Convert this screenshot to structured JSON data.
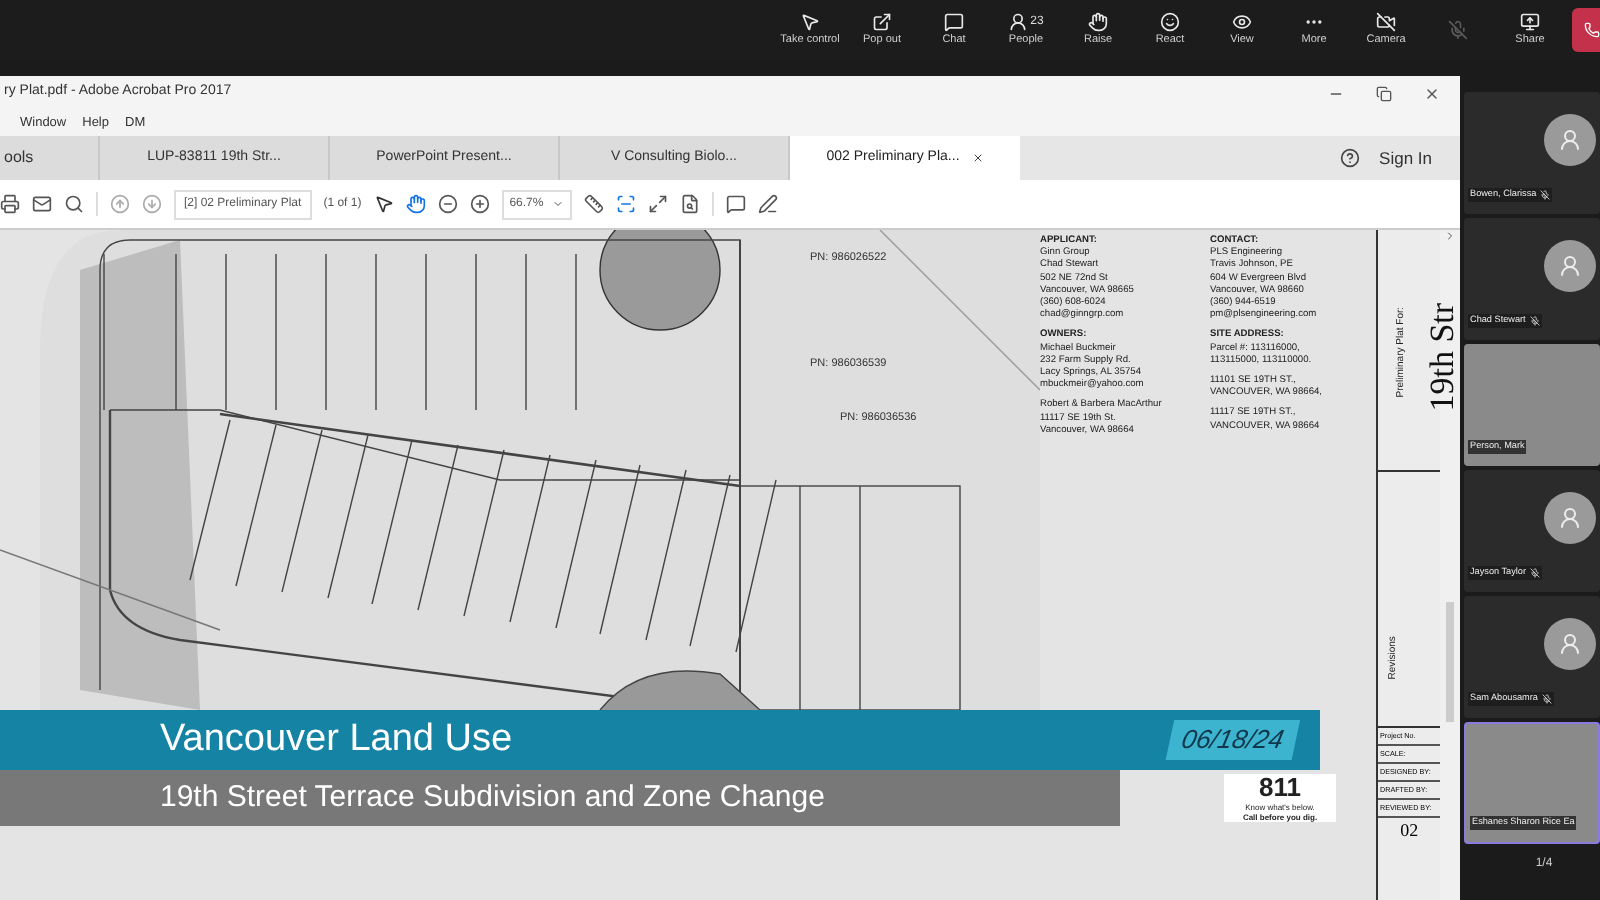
{
  "meeting_toolbar": {
    "buttons": [
      {
        "kind": "take-control",
        "label": "Take control",
        "disabled": false
      },
      {
        "kind": "pop-out",
        "label": "Pop out",
        "disabled": false
      },
      {
        "kind": "chat",
        "label": "Chat",
        "disabled": false
      },
      {
        "kind": "people",
        "label": "People",
        "badge": "23",
        "disabled": false
      },
      {
        "kind": "raise",
        "label": "Raise",
        "disabled": false
      },
      {
        "kind": "react",
        "label": "React",
        "disabled": false
      },
      {
        "kind": "view",
        "label": "View",
        "disabled": false
      },
      {
        "kind": "more",
        "label": "More",
        "disabled": false
      },
      {
        "kind": "camera",
        "label": "Camera",
        "disabled": false
      },
      {
        "kind": "mic",
        "disabled": true
      },
      {
        "kind": "share",
        "label": "Share",
        "disabled": false
      },
      {
        "kind": "leave",
        "disabled": false
      }
    ]
  },
  "acrobat": {
    "title": "ry Plat.pdf - Adobe Acrobat Pro 2017",
    "menu": [
      "Window",
      "Help",
      "DM"
    ],
    "tabs": [
      {
        "label": "ools",
        "selected": false,
        "closable": false
      },
      {
        "label": "LUP-83811 19th Str...",
        "selected": false,
        "closable": false
      },
      {
        "label": "PowerPoint Present...",
        "selected": false,
        "closable": false
      },
      {
        "label": "V Consulting Biolo...",
        "selected": false,
        "closable": false
      },
      {
        "label": "002 Preliminary Pla...",
        "selected": true,
        "closable": true
      }
    ],
    "sign_in": "Sign In",
    "toolbar": {
      "page_field": "[2] 02 Preliminary Plat",
      "page_count": "(1 of 1)",
      "zoom": "66.7%"
    }
  },
  "document": {
    "parcels": [
      "PN: 986026522",
      "PN: 986036539",
      "PN: 986036536"
    ],
    "info_columns": [
      {
        "blocks": [
          [
            "APPLICANT:",
            "Ginn Group",
            "Chad Stewart",
            "502 NE 72nd St",
            "Vancouver, WA 98665",
            "(360) 608-6024",
            "chad@ginngrp.com"
          ],
          [
            "OWNERS:",
            "Michael Buckmeir",
            "232 Farm Supply Rd.",
            "Lacy Springs, AL 35754",
            "mbuckmeir@yahoo.com"
          ],
          [
            "Robert & Barbera MacArthur",
            "11117 SE 19th St.",
            "Vancouver, WA 98664"
          ]
        ]
      },
      {
        "blocks": [
          [
            "CONTACT:",
            "PLS Engineering",
            "Travis Johnson, PE",
            "604 W Evergreen Blvd",
            "Vancouver, WA 98660",
            "(360) 944-6519",
            "pm@plsengineering.com"
          ],
          [
            "SITE ADDRESS:",
            "Parcel #: 113116000,",
            "113115000, 113110000."
          ],
          [
            "11101 SE 19TH ST.,",
            "VANCOUVER, WA 98664,"
          ],
          [
            "11117 SE 19TH ST.,",
            "VANCOUVER, WA 98664"
          ]
        ]
      }
    ],
    "title_block": {
      "heading": "Preliminary Plat For:",
      "name": "19th Str",
      "revisions": "Revisions",
      "fields": [
        "Project No.",
        "SCALE:",
        "DESIGNED BY:",
        "DRAFTED BY:",
        "REVIEWED BY:"
      ],
      "sheet": "02"
    },
    "dig_logo": {
      "number": "811",
      "line_1": "Know what's below.",
      "line_2": "Call before you dig."
    }
  },
  "lower_third": {
    "title": "Vancouver Land Use",
    "subtitle": "19th Street Terrace Subdivision and Zone Change",
    "date": "06/18/24"
  },
  "participants": [
    {
      "name": "Bowen, Clarissa",
      "kind": "avatar",
      "muted": true,
      "speaking": false
    },
    {
      "name": "Chad Stewart",
      "kind": "avatar",
      "muted": true,
      "speaking": false
    },
    {
      "name": "Person, Mark",
      "kind": "video",
      "muted": false,
      "speaking": false
    },
    {
      "name": "Jayson Taylor",
      "kind": "avatar",
      "muted": true,
      "speaking": false
    },
    {
      "name": "Sam Abousamra",
      "kind": "avatar",
      "muted": true,
      "speaking": false
    },
    {
      "name": "Eshanes Sharon Rice Ea",
      "kind": "video",
      "muted": false,
      "speaking": true
    }
  ],
  "pager": "1/4"
}
